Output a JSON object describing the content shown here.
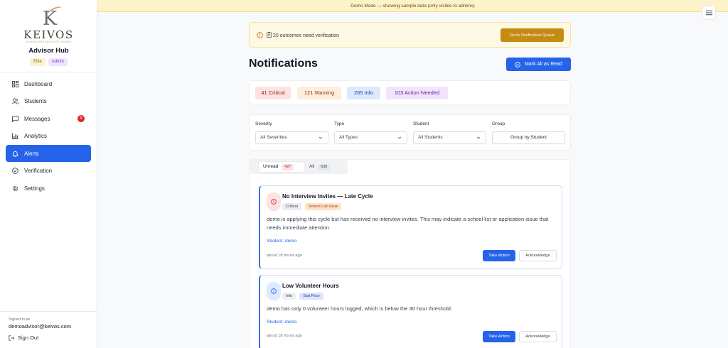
{
  "brand": {
    "logo_letter": "K",
    "wordmark": "KEIVOS",
    "tagline": "ADMISSIONS ADVISORY BOARD",
    "hub_title": "Advisor Hub",
    "badges": [
      "Elite",
      "Admin"
    ]
  },
  "sidebar": {
    "items": [
      {
        "label": "Dashboard",
        "icon": "grid-icon"
      },
      {
        "label": "Students",
        "icon": "users-icon"
      },
      {
        "label": "Messages",
        "icon": "message-icon",
        "count": "9"
      },
      {
        "label": "Analytics",
        "icon": "bar-chart-icon"
      },
      {
        "label": "Alerts",
        "icon": "bell-icon",
        "active": true
      },
      {
        "label": "Verification",
        "icon": "check-circle-icon"
      },
      {
        "label": "Settings",
        "icon": "gear-icon"
      }
    ],
    "signed_in_label": "Signed in as",
    "signed_in_email": "demoadvisor@keivos.com",
    "sign_out": "Sign Out"
  },
  "demo_banner": "Demo Mode — showing sample data (only visible to admins)",
  "verification": {
    "text": "20 outcomes need verification",
    "button": "Go to Verification Queue"
  },
  "header": {
    "title": "Notifications",
    "mark_all": "Mark All as Read"
  },
  "summary": {
    "critical": "41 Critical",
    "warning": "121 Warning",
    "info": "265 Info",
    "action": "103 Action Needed"
  },
  "filters": {
    "severity": {
      "label": "Severity",
      "value": "All Severities"
    },
    "type": {
      "label": "Type",
      "value": "All Types"
    },
    "student": {
      "label": "Student",
      "value": "All Students"
    },
    "group": {
      "label": "Group",
      "value": "Group by Student"
    }
  },
  "tabs": {
    "unread": {
      "label": "Unread",
      "count": "427"
    },
    "all": {
      "label": "All",
      "count": "530"
    }
  },
  "alerts": [
    {
      "title": "No Interview Invites — Late Cycle",
      "tags": [
        "Critical",
        "School List Issue"
      ],
      "description": "demo is applying this cycle but has received no interview invites. This may indicate a school list or application issue that needs immediate attention.",
      "student": "Student: demo",
      "time": "about 18 hours ago",
      "take_action": "Take Action",
      "acknowledge": "Acknowledge"
    },
    {
      "title": "Low Volunteer Hours",
      "tags": [
        "Info",
        "Stat Floor"
      ],
      "description": "demo has only 0 volunteer hours logged, which is below the 30 hour threshold.",
      "student": "Student: demo",
      "time": "about 18 hours ago",
      "take_action": "Take Action",
      "acknowledge": "Acknowledge"
    }
  ],
  "colors": {
    "primary": "#2563eb",
    "warning_accent": "#c58b12",
    "critical": "#dc2626",
    "banner": "#fdf3c8"
  }
}
